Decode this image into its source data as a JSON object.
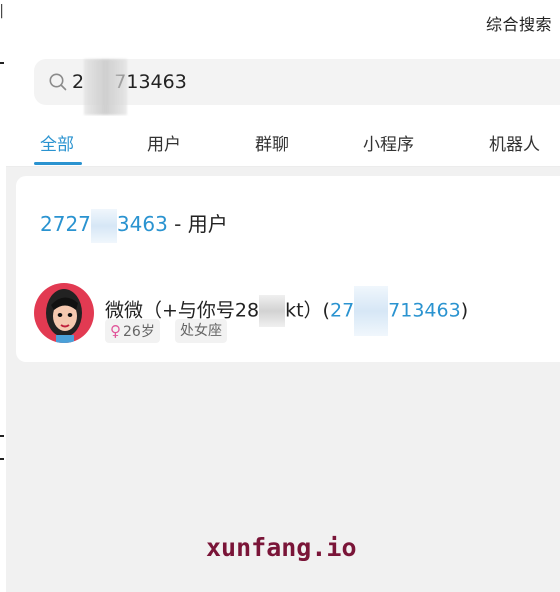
{
  "header": {
    "title": "综合搜索"
  },
  "search": {
    "query": "2     713463"
  },
  "tabs": [
    {
      "label": "全部",
      "active": true
    },
    {
      "label": "用户",
      "active": false
    },
    {
      "label": "群聊",
      "active": false
    },
    {
      "label": "小程序",
      "active": false
    },
    {
      "label": "机器人",
      "active": false
    }
  ],
  "results": {
    "query_suggestion": {
      "number_prefix": "2727",
      "number_suffix": "3463",
      "separator": " - ",
      "category": "用户"
    },
    "user": {
      "name_prefix": "微微（+与你号28",
      "name_suffix": "kt）(",
      "id_prefix": "27",
      "id_suffix": "713463",
      "close_paren": ")",
      "gender_icon": "female-icon",
      "age": "26岁",
      "zodiac": "处女座"
    }
  },
  "watermark": "xunfang.io",
  "colors": {
    "accent": "#2a93d0",
    "female": "#e0559a",
    "watermark": "#7a1538"
  }
}
